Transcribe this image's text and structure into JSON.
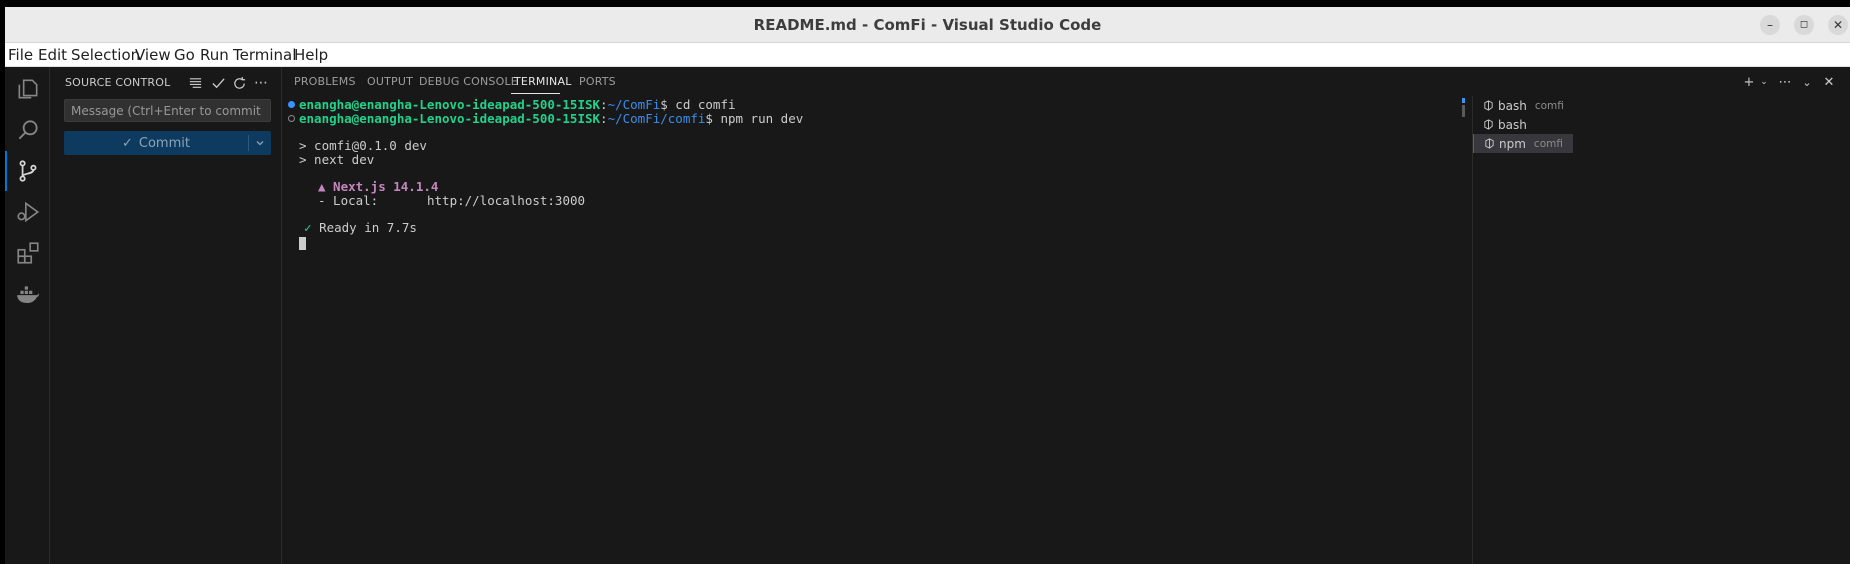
{
  "window": {
    "title": "README.md - ComFi - Visual Studio Code",
    "controls": {
      "minimize": "–",
      "maximize": "◻",
      "close": "✕"
    }
  },
  "menu": [
    "File",
    "Edit",
    "Selection",
    "View",
    "Go",
    "Run",
    "Terminal",
    "Help"
  ],
  "activity_bar": {
    "items": [
      "explorer-icon",
      "search-icon",
      "source-control-icon",
      "run-debug-icon",
      "extensions-icon",
      "docker-icon"
    ],
    "active": "source-control-icon"
  },
  "source_control": {
    "title": "SOURCE CONTROL",
    "message_placeholder": "Message (Ctrl+Enter to commit on \"f...",
    "commit_label": "Commit"
  },
  "panel": {
    "tabs": [
      "PROBLEMS",
      "OUTPUT",
      "DEBUG CONSOLE",
      "TERMINAL",
      "PORTS"
    ],
    "active_tab": "TERMINAL"
  },
  "terminal": {
    "line1": {
      "user": "enangha@enangha-Lenovo-ideapad-500-15ISK",
      "path": "~/ComFi",
      "cmd": "$ cd comfi"
    },
    "line2": {
      "user": "enangha@enangha-Lenovo-ideapad-500-15ISK",
      "path": "~/ComFi/comfi",
      "cmd": "$ npm run dev"
    },
    "line3": "> comfi@0.1.0 dev",
    "line4": "> next dev",
    "line5": "▲ Next.js 14.1.4",
    "line6_label": "- Local:",
    "line6_url": "http://localhost:3000",
    "line7_check": "✓",
    "line7_text": "Ready in 7.7s"
  },
  "terminals": [
    {
      "name": "bash",
      "cwd": "comfi"
    },
    {
      "name": "bash",
      "cwd": ""
    },
    {
      "name": "npm",
      "cwd": "comfi"
    }
  ],
  "colors": {
    "accent": "#0078d4",
    "prompt_user": "#23d18b",
    "prompt_path": "#3b8eea",
    "nextjs": "#c586c0"
  }
}
